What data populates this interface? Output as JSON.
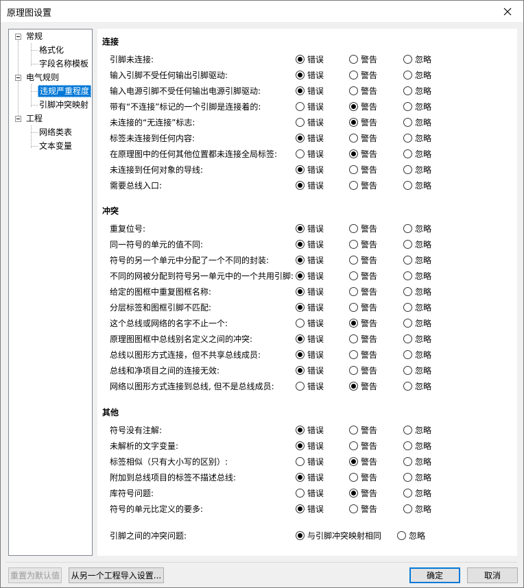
{
  "window": {
    "title": "原理图设置"
  },
  "tree": [
    {
      "label": "常规"
    },
    {
      "label": "格式化"
    },
    {
      "label": "字段名称模板"
    },
    {
      "label": "电气规则"
    },
    {
      "label": "违规严重程度"
    },
    {
      "label": "引脚冲突映射"
    },
    {
      "label": "工程"
    },
    {
      "label": "网络类表"
    },
    {
      "label": "文本变量"
    }
  ],
  "options": {
    "error": "错误",
    "warning": "警告",
    "ignore": "忽略"
  },
  "sections": [
    {
      "title": "连接",
      "rules": [
        {
          "label": "引脚未连接:",
          "selected": "error"
        },
        {
          "label": "输入引脚不受任何输出引脚驱动:",
          "selected": "error"
        },
        {
          "label": "输入电源引脚不受任何输出电源引脚驱动:",
          "selected": "error"
        },
        {
          "label": "带有“不连接”标记的一个引脚是连接着的:",
          "selected": "warning"
        },
        {
          "label": "未连接的“无连接”标志:",
          "selected": "warning"
        },
        {
          "label": "标签未连接到任何内容:",
          "selected": "error"
        },
        {
          "label": "在原理图中的任何其他位置都未连接全局标签:",
          "selected": "warning"
        },
        {
          "label": "未连接到任何对象的导线:",
          "selected": "error"
        },
        {
          "label": "需要总线入口:",
          "selected": "error"
        }
      ]
    },
    {
      "title": "冲突",
      "rules": [
        {
          "label": "重复位号:",
          "selected": "error"
        },
        {
          "label": "同一符号的单元的值不同:",
          "selected": "error"
        },
        {
          "label": "符号的另一个单元中分配了一个不同的封装:",
          "selected": "error"
        },
        {
          "label": "不同的网被分配到符号另一单元中的一个共用引脚:",
          "selected": "error"
        },
        {
          "label": "给定的图框中重复图框名称:",
          "selected": "error"
        },
        {
          "label": "分层标签和图框引脚不匹配:",
          "selected": "error"
        },
        {
          "label": "这个总线或网络的名字不止一个:",
          "selected": "warning"
        },
        {
          "label": "原理图图框中总线别名定义之间的冲突:",
          "selected": "error"
        },
        {
          "label": "总线以图形方式连接，但不共享总线成员:",
          "selected": "error"
        },
        {
          "label": "总线和净项目之间的连接无效:",
          "selected": "error"
        },
        {
          "label": "网络以图形方式连接到总线, 但不是总线成员:",
          "selected": "warning"
        }
      ]
    },
    {
      "title": "其他",
      "rules": [
        {
          "label": "符号没有注解:",
          "selected": "error"
        },
        {
          "label": "未解析的文字变量:",
          "selected": "error"
        },
        {
          "label": "标签相似（只有大小写的区别）:",
          "selected": "warning"
        },
        {
          "label": "附加到总线项目的标签不描述总线:",
          "selected": "error"
        },
        {
          "label": "库符号问题:",
          "selected": "warning"
        },
        {
          "label": "符号的单元比定义的要多:",
          "selected": "error"
        }
      ]
    }
  ],
  "pin_conflict": {
    "label": "引脚之间的冲突问题:",
    "option_map": "与引脚冲突映射相同",
    "option_ignore": "忽略",
    "selected": "map"
  },
  "buttons": {
    "reset": "重置为默认值",
    "import": "从另一个工程导入设置...",
    "ok": "确定",
    "cancel": "取消"
  }
}
